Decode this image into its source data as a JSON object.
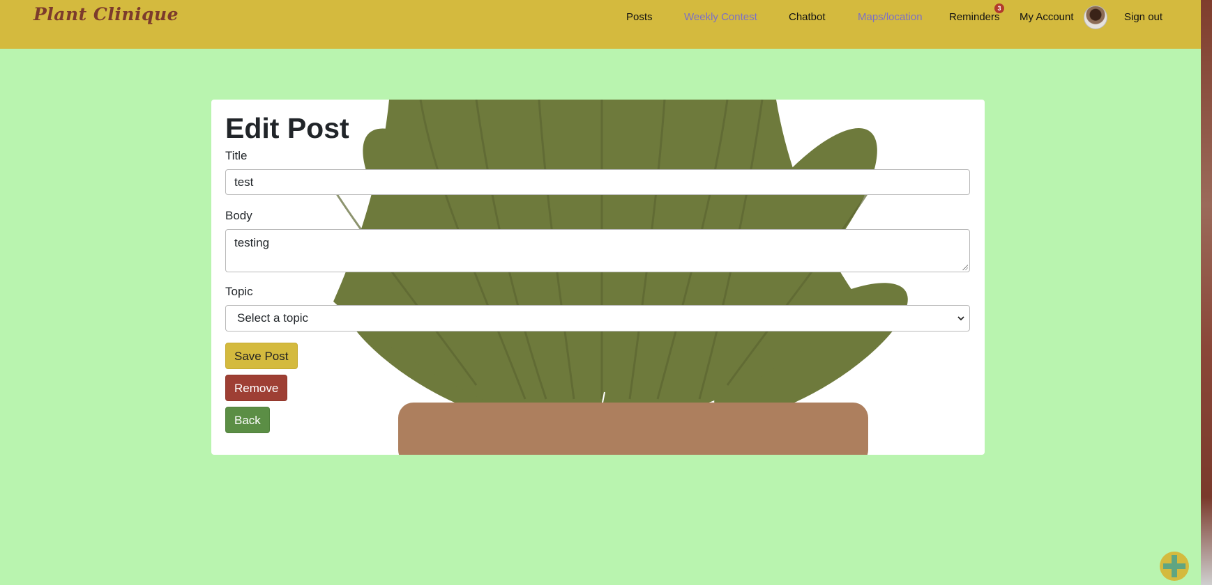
{
  "brand": "Plant Clinique",
  "nav": {
    "posts": "Posts",
    "weekly_contest": "Weekly Contest",
    "chatbot": "Chatbot",
    "maps": "Maps/location",
    "reminders": "Reminders",
    "reminders_badge": "3",
    "my_account": "My Account",
    "sign_out": "Sign out"
  },
  "form": {
    "heading": "Edit Post",
    "title_label": "Title",
    "title_value": "test",
    "body_label": "Body",
    "body_value": "testing",
    "topic_label": "Topic",
    "topic_selected": "Select a topic",
    "save_label": "Save Post",
    "remove_label": "Remove",
    "back_label": "Back"
  },
  "colors": {
    "page_bg": "#b9f4af",
    "navbar_bg": "#d4ba3e",
    "brand_text": "#7c3b2c",
    "save_button": "#d4ba3e",
    "remove_button": "#9e3f34",
    "back_button": "#5b8e45",
    "leaf": "#707a3d",
    "pot": "#ad7f5e"
  },
  "icons": {
    "fab": "plus-icon",
    "select": "chevron-down-icon",
    "avatar": "user-avatar"
  }
}
